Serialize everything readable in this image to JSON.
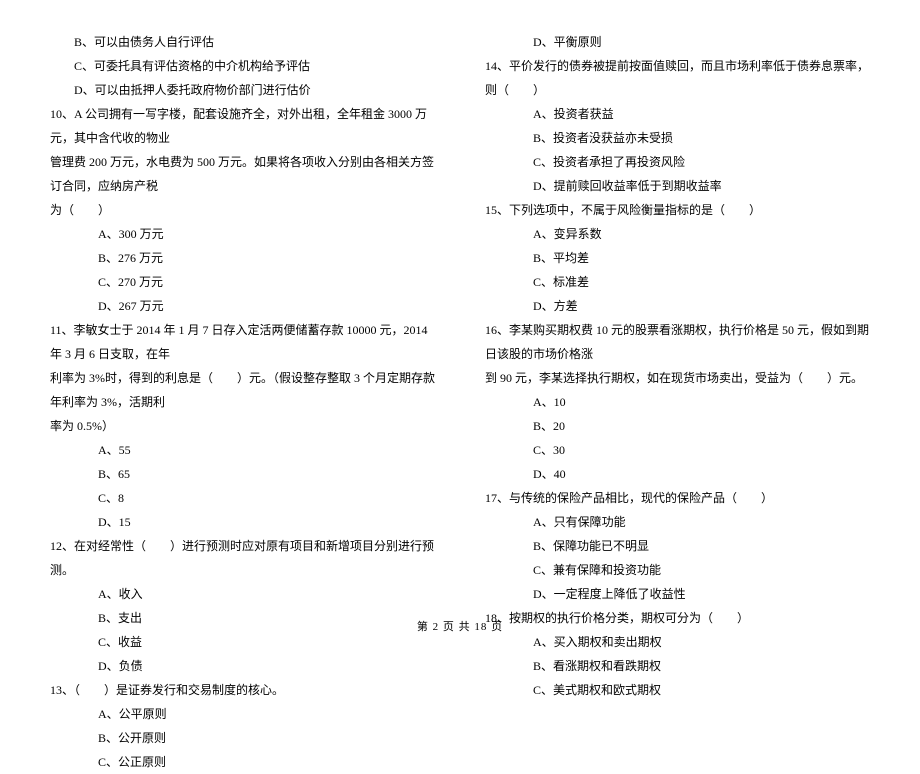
{
  "left": [
    {
      "cls": "indent-2",
      "t": "B、可以由债务人自行评估"
    },
    {
      "cls": "indent-2",
      "t": "C、可委托具有评估资格的中介机构给予评估"
    },
    {
      "cls": "indent-2",
      "t": "D、可以由抵押人委托政府物价部门进行估价"
    },
    {
      "cls": "indent-1",
      "t": "10、A 公司拥有一写字楼，配套设施齐全，对外出租，全年租金 3000 万元，其中含代收的物业"
    },
    {
      "cls": "indent-1",
      "t": "管理费 200 万元，水电费为 500 万元。如果将各项收入分别由各相关方签订合同，应纳房产税"
    },
    {
      "cls": "indent-1",
      "t": "为（　　）"
    },
    {
      "cls": "indent-3",
      "t": "A、300 万元"
    },
    {
      "cls": "indent-3",
      "t": "B、276 万元"
    },
    {
      "cls": "indent-3",
      "t": "C、270 万元"
    },
    {
      "cls": "indent-3",
      "t": "D、267 万元"
    },
    {
      "cls": "indent-1",
      "t": "11、李敏女士于 2014 年 1 月 7 日存入定活两便储蓄存款 10000 元，2014 年 3 月 6 日支取，在年"
    },
    {
      "cls": "indent-1",
      "t": "利率为 3%时，得到的利息是（　　）元。（假设整存整取 3 个月定期存款年利率为 3%，活期利"
    },
    {
      "cls": "indent-1",
      "t": "率为 0.5%）"
    },
    {
      "cls": "indent-3",
      "t": "A、55"
    },
    {
      "cls": "indent-3",
      "t": "B、65"
    },
    {
      "cls": "indent-3",
      "t": "C、8"
    },
    {
      "cls": "indent-3",
      "t": "D、15"
    },
    {
      "cls": "indent-1",
      "t": "12、在对经常性（　　）进行预测时应对原有项目和新增项目分别进行预测。"
    },
    {
      "cls": "indent-3",
      "t": "A、收入"
    },
    {
      "cls": "indent-3",
      "t": "B、支出"
    },
    {
      "cls": "indent-3",
      "t": "C、收益"
    },
    {
      "cls": "indent-3",
      "t": "D、负债"
    },
    {
      "cls": "indent-1",
      "t": "13、（　　）是证券发行和交易制度的核心。"
    },
    {
      "cls": "indent-3",
      "t": "A、公平原则"
    },
    {
      "cls": "indent-3",
      "t": "B、公开原则"
    },
    {
      "cls": "indent-3",
      "t": "C、公正原则"
    }
  ],
  "right": [
    {
      "cls": "indent-3",
      "t": "D、平衡原则"
    },
    {
      "cls": "indent-1",
      "t": "14、平价发行的债券被提前按面值赎回，而且市场利率低于债券息票率，则（　　）"
    },
    {
      "cls": "indent-3",
      "t": "A、投资者获益"
    },
    {
      "cls": "indent-3",
      "t": "B、投资者没获益亦未受损"
    },
    {
      "cls": "indent-3",
      "t": "C、投资者承担了再投资风险"
    },
    {
      "cls": "indent-3",
      "t": "D、提前赎回收益率低于到期收益率"
    },
    {
      "cls": "indent-1",
      "t": "15、下列选项中，不属于风险衡量指标的是（　　）"
    },
    {
      "cls": "indent-3",
      "t": "A、变异系数"
    },
    {
      "cls": "indent-3",
      "t": "B、平均差"
    },
    {
      "cls": "indent-3",
      "t": "C、标准差"
    },
    {
      "cls": "indent-3",
      "t": "D、方差"
    },
    {
      "cls": "indent-1",
      "t": "16、李某购买期权费 10 元的股票看涨期权，执行价格是 50 元，假如到期日该股的市场价格涨"
    },
    {
      "cls": "indent-1",
      "t": "到 90 元，李某选择执行期权，如在现货市场卖出，受益为（　　）元。"
    },
    {
      "cls": "indent-3",
      "t": "A、10"
    },
    {
      "cls": "indent-3",
      "t": "B、20"
    },
    {
      "cls": "indent-3",
      "t": "C、30"
    },
    {
      "cls": "indent-3",
      "t": "D、40"
    },
    {
      "cls": "indent-1",
      "t": "17、与传统的保险产品相比，现代的保险产品（　　）"
    },
    {
      "cls": "indent-3",
      "t": "A、只有保障功能"
    },
    {
      "cls": "indent-3",
      "t": "B、保障功能已不明显"
    },
    {
      "cls": "indent-3",
      "t": "C、兼有保障和投资功能"
    },
    {
      "cls": "indent-3",
      "t": "D、一定程度上降低了收益性"
    },
    {
      "cls": "indent-1",
      "t": "18、按期权的执行价格分类，期权可分为（　　）"
    },
    {
      "cls": "indent-3",
      "t": "A、买入期权和卖出期权"
    },
    {
      "cls": "indent-3",
      "t": "B、看涨期权和看跌期权"
    },
    {
      "cls": "indent-3",
      "t": "C、美式期权和欧式期权"
    }
  ],
  "footer": "第 2 页 共 18 页"
}
